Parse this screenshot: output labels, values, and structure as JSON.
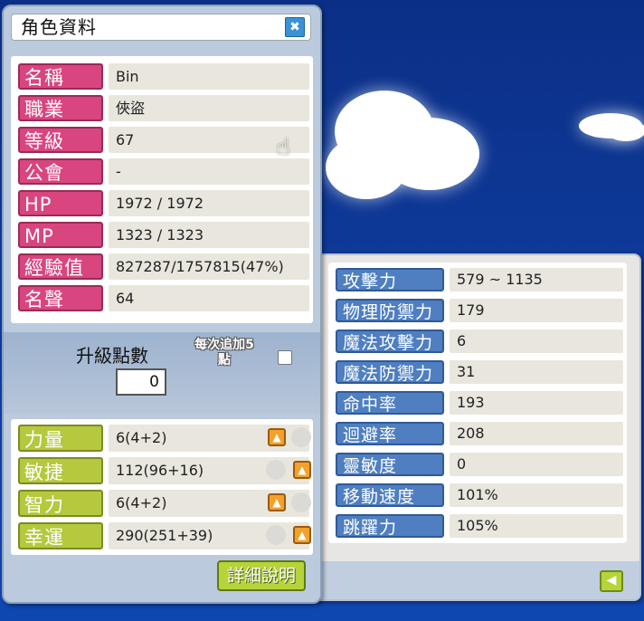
{
  "window": {
    "title": "角色資料"
  },
  "profile": [
    {
      "label": "名稱",
      "value": "Bin"
    },
    {
      "label": "職業",
      "value": "俠盜"
    },
    {
      "label": "等級",
      "value": "67"
    },
    {
      "label": "公會",
      "value": "-"
    },
    {
      "label": "HP",
      "value": "1972 / 1972"
    },
    {
      "label": "MP",
      "value": "1323 / 1323"
    },
    {
      "label": "經驗值",
      "value": "827287/1757815(47%)"
    },
    {
      "label": "名聲",
      "value": "64"
    }
  ],
  "level_points": {
    "label": "升級點數",
    "value": "0",
    "auto_add_label": "每次追加5\n點"
  },
  "stats": [
    {
      "label": "力量",
      "value": "6(4+2)"
    },
    {
      "label": "敏捷",
      "value": "112(96+16)"
    },
    {
      "label": "智力",
      "value": "6(4+2)"
    },
    {
      "label": "幸運",
      "value": "290(251+39)"
    }
  ],
  "detail_button": "詳細說明",
  "details": [
    {
      "label": "攻擊力",
      "value": "579 ~ 1135"
    },
    {
      "label": "物理防禦力",
      "value": "179"
    },
    {
      "label": "魔法攻擊力",
      "value": "6"
    },
    {
      "label": "魔法防禦力",
      "value": "31"
    },
    {
      "label": "命中率",
      "value": "193"
    },
    {
      "label": "迴避率",
      "value": "208"
    },
    {
      "label": "靈敏度",
      "value": "0"
    },
    {
      "label": "移動速度",
      "value": "101%"
    },
    {
      "label": "跳躍力",
      "value": "105%"
    }
  ],
  "icons": {
    "close": "close-x-icon",
    "back": "arrow-left-icon",
    "stat_up": "arrow-up-icon",
    "cursor": "hand-cursor-icon"
  },
  "colors": {
    "profile_label": "#d9457f",
    "stat_label": "#b6c83d",
    "detail_label": "#4f7fc0",
    "sky": "#0e3a9a"
  }
}
